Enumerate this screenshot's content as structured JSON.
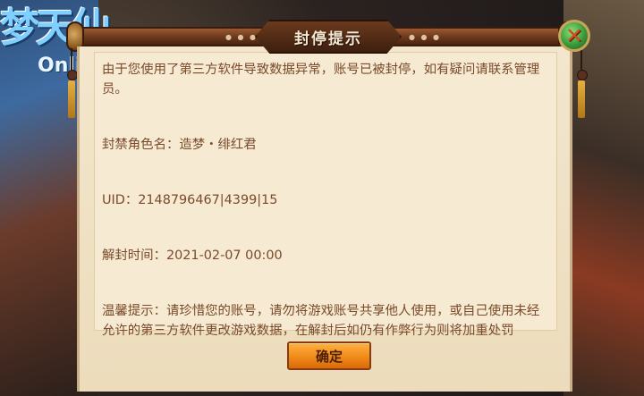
{
  "background": {
    "logo_main": "梦天仙",
    "logo_sub": "Onli"
  },
  "dialog": {
    "title": "封停提示",
    "close_glyph": "✕",
    "message": "由于您使用了第三方软件导致数据异常，账号已被封停，如有疑问请联系管理员。",
    "banned_role": "封禁角色名：造梦・绯红君",
    "uid": "UID：2148796467|4399|15",
    "unban_time": "解封时间：2021-02-07 00:00",
    "warning": "温馨提示：请珍惜您的账号，请勿将游戏账号共享他人使用，或自己使用未经允许的第三方软件更改游戏数据，在解封后如仍有作弊行为则将加重处罚",
    "confirm_label": "确定"
  },
  "colors": {
    "parchment": "#f6ead2",
    "text": "#7a4a2a",
    "button": "#f08a1a",
    "close_button": "#3a9a3a"
  }
}
